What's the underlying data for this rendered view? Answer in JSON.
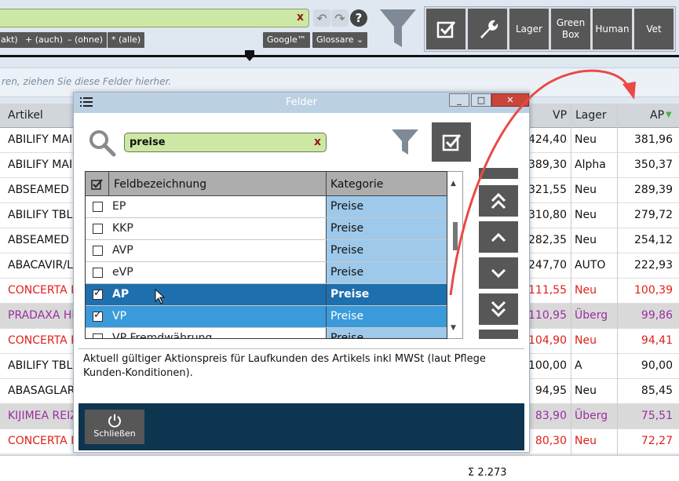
{
  "toolbar": {
    "search_value": "",
    "chips": [
      "akt)",
      "+ (auch)",
      "– (ohne)",
      "* (alle)"
    ],
    "google_label": "Google™",
    "glossare_label": "Glossare ⌄",
    "big_buttons": [
      "Lager",
      "Green Box",
      "Human",
      "Vet"
    ]
  },
  "group_hint": "ren, ziehen Sie diese Felder hierher.",
  "grid": {
    "headers": {
      "artikel": "Artikel",
      "vp": "VP",
      "lager": "Lager",
      "ap": "AP"
    },
    "rows": [
      {
        "artikel": "ABILIFY MAIN",
        "vp": "424,40",
        "lager": "Neu",
        "ap": "381,96",
        "style": "normal"
      },
      {
        "artikel": "ABILIFY MAIN",
        "vp": "389,30",
        "lager": "Alpha",
        "ap": "350,37",
        "style": "normal"
      },
      {
        "artikel": "ABSEAMED INJ",
        "vp": "321,55",
        "lager": "Neu",
        "ap": "289,39",
        "style": "normal"
      },
      {
        "artikel": "ABILIFY TBL",
        "vp": "310,80",
        "lager": "Neu",
        "ap": "279,72",
        "style": "normal"
      },
      {
        "artikel": "ABSEAMED INJ",
        "vp": "282,35",
        "lager": "Neu",
        "ap": "254,12",
        "style": "normal"
      },
      {
        "artikel": "ABACAVIR/LA",
        "vp": "247,70",
        "lager": "AUTO",
        "ap": "222,93",
        "style": "normal"
      },
      {
        "artikel": "CONCERTA RE",
        "vp": "111,55",
        "lager": "Neu",
        "ap": "100,39",
        "style": "red"
      },
      {
        "artikel": "PRADAXA HK",
        "vp": "110,95",
        "lager": "Überg",
        "ap": "99,86",
        "style": "purple"
      },
      {
        "artikel": "CONCERTA RE",
        "vp": "104,90",
        "lager": "Neu",
        "ap": "94,41",
        "style": "red"
      },
      {
        "artikel": "ABILIFY TBL",
        "vp": "100,00",
        "lager": "A",
        "ap": "90,00",
        "style": "normal"
      },
      {
        "artikel": "ABASAGLAR I",
        "vp": "94,95",
        "lager": "Neu",
        "ap": "85,45",
        "style": "normal"
      },
      {
        "artikel": "KIJIMEA REIZ",
        "vp": "83,90",
        "lager": "Überg",
        "ap": "75,51",
        "style": "purple"
      },
      {
        "artikel": "CONCERTA RE",
        "vp": "80,30",
        "lager": "Neu",
        "ap": "72,27",
        "style": "red"
      }
    ],
    "sum_label": "Σ 2.273"
  },
  "dialog": {
    "title": "Felder",
    "search_value": "preise",
    "list_headers": {
      "name": "Feldbezeichnung",
      "category": "Kategorie"
    },
    "fields": [
      {
        "name": "EP",
        "category": "Preise",
        "checked": false,
        "state": ""
      },
      {
        "name": "KKP",
        "category": "Preise",
        "checked": false,
        "state": ""
      },
      {
        "name": "AVP",
        "category": "Preise",
        "checked": false,
        "state": ""
      },
      {
        "name": "eVP",
        "category": "Preise",
        "checked": false,
        "state": ""
      },
      {
        "name": "AP",
        "category": "Preise",
        "checked": true,
        "state": "sel"
      },
      {
        "name": "VP",
        "category": "Preise",
        "checked": true,
        "state": "hl"
      },
      {
        "name": "VP Fremdwährung",
        "category": "Preise",
        "checked": false,
        "state": ""
      }
    ],
    "description": "Aktuell gültiger Aktionspreis für Laufkunden des Artikels inkl MWSt (laut Pflege Kunden-Konditionen).",
    "close_label": "Schließen"
  },
  "colors": {
    "red_row": "#e0201a",
    "purple_row": "#9b2fa0",
    "selected": "#1e6fad",
    "highlight": "#3b9ad9",
    "annotation": "#e94a45"
  }
}
